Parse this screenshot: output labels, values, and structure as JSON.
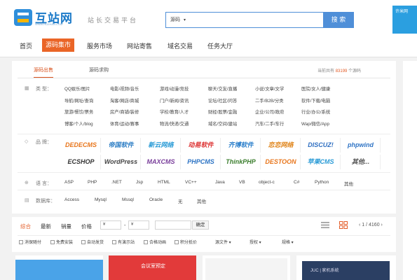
{
  "header": {
    "logo_text": "互站网",
    "logo_domain": "WWW.HUZHAN.COM",
    "slogan": "站长交易平台",
    "search_select": "源码",
    "search_button": "搜 索",
    "promo_text": "许米网"
  },
  "nav": {
    "items": [
      "首页",
      "源码集市",
      "服务市场",
      "网站寄售",
      "域名交易",
      "任务大厅"
    ],
    "active": "源码集市"
  },
  "panel": {
    "tabs": [
      "源码出售",
      "源码求购"
    ],
    "count_prefix": "当前共有",
    "count_value": "83199",
    "count_suffix": "个源码",
    "type_label": "类 型：",
    "categories": [
      [
        "QQ娱乐/图片",
        "电影/视频/音乐",
        "游戏/动漫/竞技",
        "聊天/交友/直播",
        "小说/文章/文学",
        "医院/女人/健康"
      ],
      [
        "导航/网址/查询",
        "淘客/网店/商城",
        "门户/新闻/资讯",
        "论坛/社区/问答",
        "二手/B2B/分类",
        "软件/下载/电脑"
      ],
      [
        "旅游/餐饮/票务",
        "房产/商铺/装修",
        "学校/教育/人才",
        "财经/股票/金融",
        "企业/公司/政府",
        "行业/办公/系统"
      ],
      [
        "博客/个人/blog",
        "体育/运动/赛事",
        "物流/快递/交通",
        "域名/空间/建站",
        "汽车/二手/车行",
        "Wap/微信/App"
      ]
    ],
    "brand_label": "品 牌：",
    "brands": [
      [
        "DEDECMS",
        "帝国软件",
        "新云网络",
        "动易软件",
        "齐博软件",
        "恋恋网络",
        "DISCUZ!",
        "phpwind"
      ],
      [
        "ECSHOP",
        "WordPress",
        "MAXCMS",
        "PHPCMS",
        "ThinkPHP",
        "DESTOON",
        "苹果CMS",
        "其他..."
      ]
    ],
    "lang_label": "语 言：",
    "languages": [
      "ASP",
      "PHP",
      ".NET",
      "Jsp",
      "HTML",
      "VC++",
      "Java",
      "VB",
      "object-c",
      "C#",
      "Python",
      "其他"
    ],
    "db_label": "数据库：",
    "databases": [
      "Access",
      "Mysql",
      "Mssql",
      "Oracle",
      "无",
      "其他"
    ]
  },
  "filter": {
    "sorts": [
      "综合",
      "最新",
      "销量",
      "价格"
    ],
    "price_from": "¥",
    "price_to": "¥",
    "price_dash": "-",
    "ok": "确定",
    "page": "1 / 4160",
    "checkboxes": [
      "消保随付",
      "免费安装",
      "自动发货",
      "有演示站",
      "合格动画",
      "积分抵价"
    ],
    "dropdowns": [
      "源文件",
      "授权",
      "规格"
    ]
  },
  "cards": [
    "",
    "会议室预定",
    "",
    "JUC | 家机系统"
  ],
  "colors": {
    "accent": "#ea6527",
    "blue": "#4f8fd8",
    "price": "#e35b26"
  }
}
